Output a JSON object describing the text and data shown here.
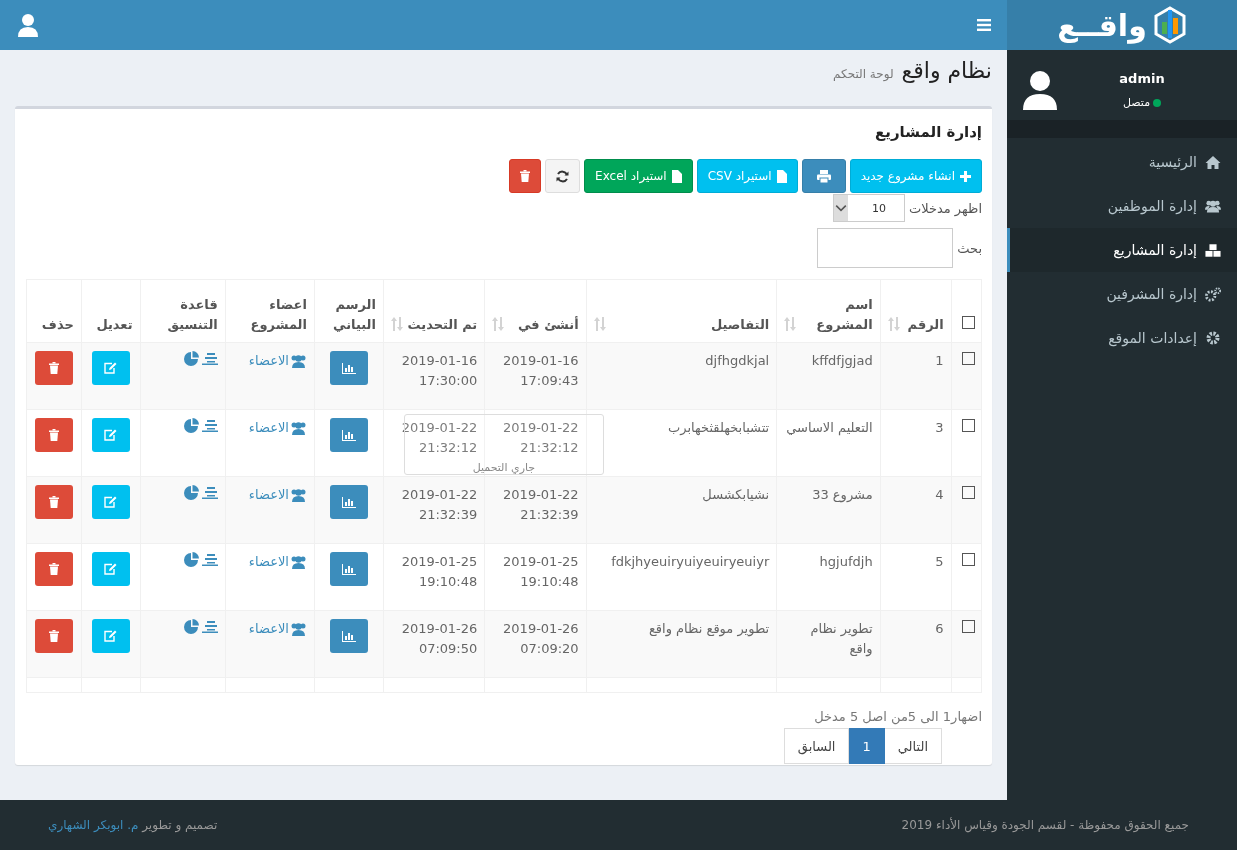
{
  "brand": {
    "logo_text": "واقــع"
  },
  "user": {
    "name": "admin",
    "status": "متصل",
    "online": true
  },
  "sidebar": {
    "items": [
      {
        "label": "الرئيسية",
        "kind": "home",
        "selected": false
      },
      {
        "label": "إدارة الموظفين",
        "kind": "staff",
        "selected": false
      },
      {
        "label": "إدارة المشاريع",
        "kind": "projects",
        "selected": true
      },
      {
        "label": "إدارة المشرفين",
        "kind": "supervisors",
        "selected": false
      },
      {
        "label": "إعدادات الموقع",
        "kind": "settings",
        "selected": false
      }
    ]
  },
  "page": {
    "title": "نظام واقع",
    "subtitle": "لوحة التحكم"
  },
  "box": {
    "title": "إدارة المشاريع"
  },
  "toolbar": [
    {
      "kind": "create",
      "label": "انشاء مشروع جديد"
    },
    {
      "kind": "print"
    },
    {
      "kind": "csv",
      "label": "استيراد CSV"
    },
    {
      "kind": "excel",
      "label": "استيراد Excel"
    },
    {
      "kind": "refresh"
    },
    {
      "kind": "delete"
    }
  ],
  "length": {
    "label": "اظهر مدخلات",
    "value": "10"
  },
  "search": {
    "label": "بحث"
  },
  "table": {
    "select_all": {
      "checked": false
    },
    "columns": [
      {
        "label": "الرقم",
        "sortable": true
      },
      {
        "label": "اسم المشروع",
        "sortable": true
      },
      {
        "label": "التفاصيل",
        "sortable": true
      },
      {
        "label": "أنشئ في",
        "sortable": true
      },
      {
        "label": "تم التحديث",
        "sortable": true
      },
      {
        "label": "الرسم البياني",
        "sortable": false
      },
      {
        "label": "اعضاء المشروع",
        "sortable": false
      },
      {
        "label": "قاعدة التنسيق",
        "sortable": false
      },
      {
        "label": "تعديل",
        "sortable": false
      },
      {
        "label": "حذف",
        "sortable": false
      }
    ],
    "rows": [
      {
        "checked": false,
        "number": "1",
        "name": "kffdfjgjad",
        "details": "djfhgdkjal",
        "created": "2019-01-16 17:09:43",
        "updated": "2019-01-16 17:30:00",
        "members": "الاعضاء"
      },
      {
        "checked": false,
        "number": "3",
        "name": "التعليم الاساسي",
        "details": "تتشبابخهلقثخهابرب",
        "created": "2019-01-22 21:32:12",
        "updated": "2019-01-22 21:32:12",
        "members": "الاعضاء"
      },
      {
        "checked": false,
        "number": "4",
        "name": "مشروع 33",
        "details": "نشيابكشسل",
        "created": "2019-01-22 21:32:39",
        "updated": "2019-01-22 21:32:39",
        "members": "الاعضاء"
      },
      {
        "checked": false,
        "number": "5",
        "name": "hgjufdjh",
        "details": "fdkjhyeuiryuiyeuiryeuiyr",
        "created": "2019-01-25 19:10:48",
        "updated": "2019-01-25 19:10:48",
        "members": "الاعضاء"
      },
      {
        "checked": false,
        "number": "6",
        "name": "تطوير نظام واقع",
        "details": "تطوير موقع نظام واقع",
        "created": "2019-01-26 07:09:20",
        "updated": "2019-01-26 07:09:50",
        "members": "الاعضاء"
      }
    ]
  },
  "processing": "جاري التحميل",
  "info": "اضهار1 الى 5من اصل 5 مدخل",
  "pagination": [
    {
      "label": "التالي",
      "selected": false
    },
    {
      "label": "1",
      "selected": true
    },
    {
      "label": "السابق",
      "selected": false
    }
  ],
  "footer": {
    "copyright": "جميع الحقوق محفوظة - لقسم الجودة وقياس الأداء 2019",
    "credit": "تصميم و تطوير",
    "author": "م. ابوبكر الشهاري"
  }
}
